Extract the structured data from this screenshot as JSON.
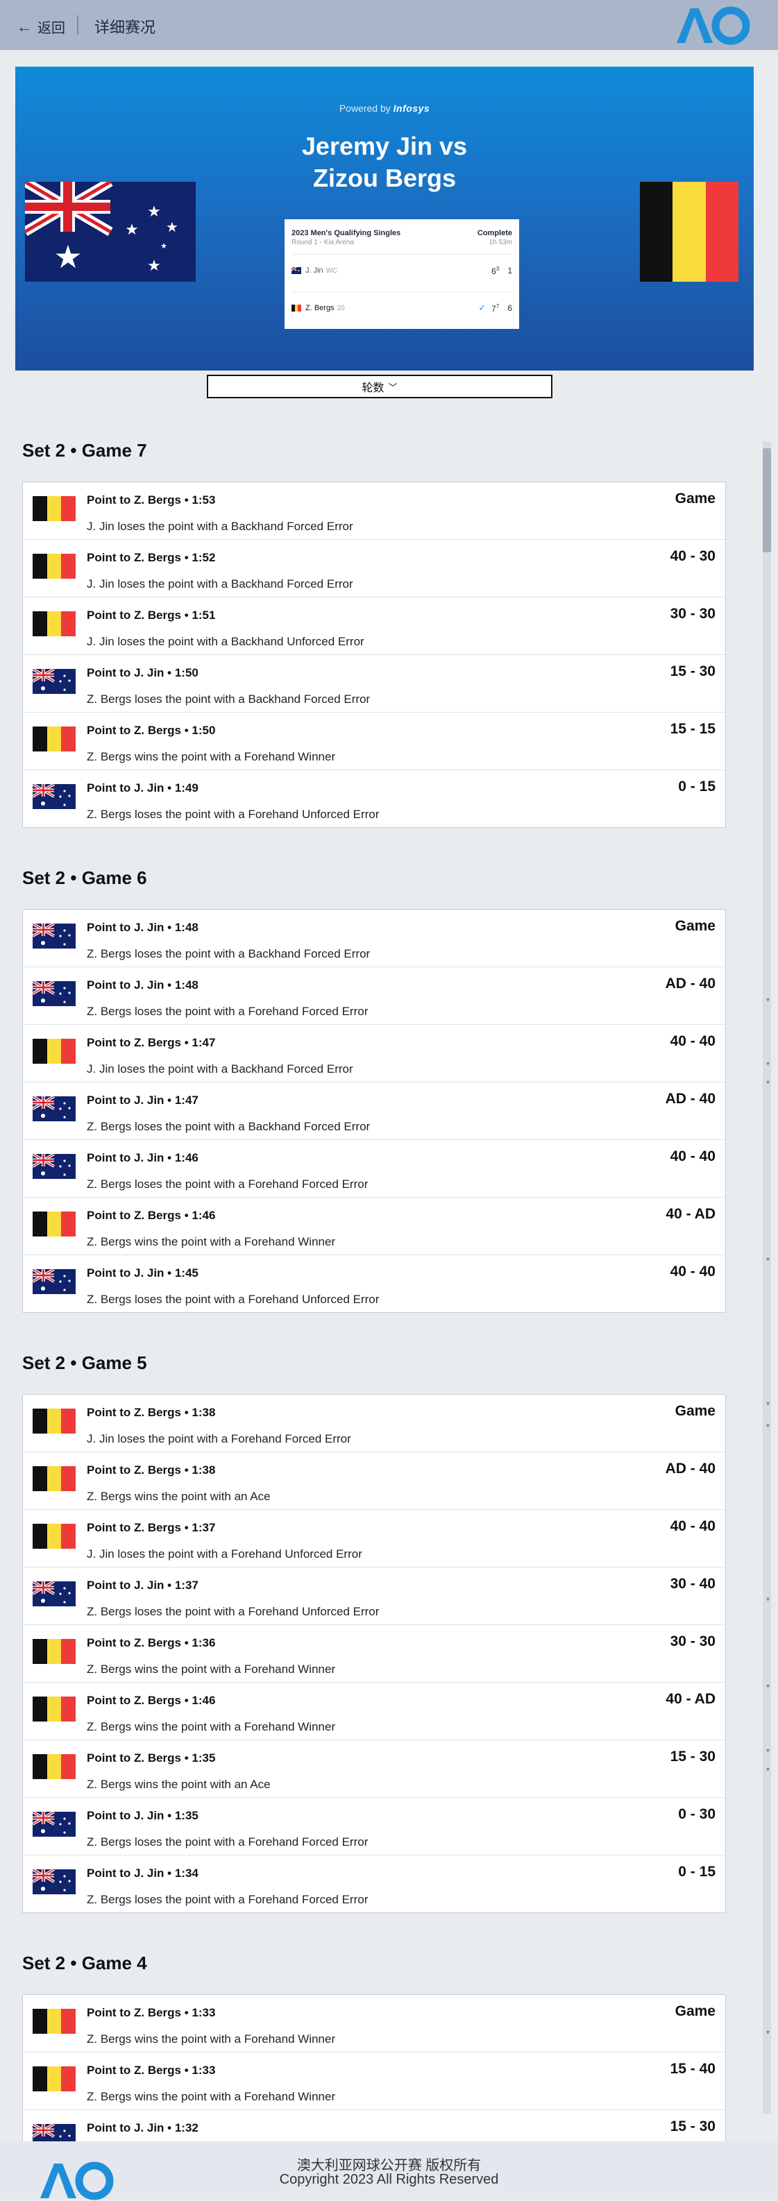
{
  "header": {
    "back_label": "返回",
    "title": "详细赛况"
  },
  "hero": {
    "powered_by": "Powered by",
    "powered_brand": "Infosys",
    "title_line1": "Jeremy Jin vs",
    "title_line2": "Zizou Bergs",
    "scorecard": {
      "event": "2023 Men's Qualifying Singles",
      "round": "Round 1 - Kia Arena",
      "status": "Complete",
      "duration": "1h 53m",
      "player1": {
        "name": "J. Jin",
        "seed": "WC",
        "set1": "6",
        "set1_tb": "3",
        "set2": "1"
      },
      "player2": {
        "name": "Z. Bergs",
        "seed": "20",
        "set1": "7",
        "set1_tb": "7",
        "set2": "6"
      }
    }
  },
  "rounds_select": {
    "label": "轮数"
  },
  "sets": [
    {
      "title": "Set 2 • Game 7",
      "points": [
        {
          "flag": "be",
          "title": "Point to Z. Bergs • 1:53",
          "desc": "J. Jin loses the point with a Backhand Forced Error",
          "score": "Game"
        },
        {
          "flag": "be",
          "title": "Point to Z. Bergs • 1:52",
          "desc": "J. Jin loses the point with a Backhand Forced Error",
          "score": "40 - 30"
        },
        {
          "flag": "be",
          "title": "Point to Z. Bergs • 1:51",
          "desc": "J. Jin loses the point with a Backhand Unforced Error",
          "score": "30 - 30"
        },
        {
          "flag": "au",
          "title": "Point to J. Jin • 1:50",
          "desc": "Z. Bergs loses the point with a Backhand Forced Error",
          "score": "15 - 30"
        },
        {
          "flag": "be",
          "title": "Point to Z. Bergs • 1:50",
          "desc": "Z. Bergs wins the point with a Forehand Winner",
          "score": "15 - 15"
        },
        {
          "flag": "au",
          "title": "Point to J. Jin • 1:49",
          "desc": "Z. Bergs loses the point with a Forehand Unforced Error",
          "score": "0 - 15"
        }
      ]
    },
    {
      "title": "Set 2 • Game 6",
      "points": [
        {
          "flag": "au",
          "title": "Point to J. Jin • 1:48",
          "desc": "Z. Bergs loses the point with a Backhand Forced Error",
          "score": "Game"
        },
        {
          "flag": "au",
          "title": "Point to J. Jin • 1:48",
          "desc": "Z. Bergs loses the point with a Forehand Forced Error",
          "score": "AD - 40"
        },
        {
          "flag": "be",
          "title": "Point to Z. Bergs • 1:47",
          "desc": "J. Jin loses the point with a Backhand Forced Error",
          "score": "40 - 40"
        },
        {
          "flag": "au",
          "title": "Point to J. Jin • 1:47",
          "desc": "Z. Bergs loses the point with a Backhand Forced Error",
          "score": "AD - 40"
        },
        {
          "flag": "au",
          "title": "Point to J. Jin • 1:46",
          "desc": "Z. Bergs loses the point with a Forehand Forced Error",
          "score": "40 - 40"
        },
        {
          "flag": "be",
          "title": "Point to Z. Bergs • 1:46",
          "desc": "Z. Bergs wins the point with a Forehand Winner",
          "score": "40 - AD"
        },
        {
          "flag": "au",
          "title": "Point to J. Jin • 1:45",
          "desc": "Z. Bergs loses the point with a Forehand Unforced Error",
          "score": "40 - 40"
        }
      ]
    },
    {
      "title": "Set 2 • Game 5",
      "points": [
        {
          "flag": "be",
          "title": "Point to Z. Bergs • 1:38",
          "desc": "J. Jin loses the point with a Forehand Forced Error",
          "score": "Game"
        },
        {
          "flag": "be",
          "title": "Point to Z. Bergs • 1:38",
          "desc": "Z. Bergs wins the point with an Ace",
          "score": "AD - 40"
        },
        {
          "flag": "be",
          "title": "Point to Z. Bergs • 1:37",
          "desc": "J. Jin loses the point with a Forehand Unforced Error",
          "score": "40 - 40"
        },
        {
          "flag": "au",
          "title": "Point to J. Jin • 1:37",
          "desc": "Z. Bergs loses the point with a Forehand Unforced Error",
          "score": "30 - 40"
        },
        {
          "flag": "be",
          "title": "Point to Z. Bergs • 1:36",
          "desc": "Z. Bergs wins the point with a Forehand Winner",
          "score": "30 - 30"
        },
        {
          "flag": "be",
          "title": "Point to Z. Bergs • 1:46",
          "desc": "Z. Bergs wins the point with a Forehand Winner",
          "score": "40 - AD"
        },
        {
          "flag": "be",
          "title": "Point to Z. Bergs • 1:35",
          "desc": "Z. Bergs wins the point with an Ace",
          "score": "15 - 30"
        },
        {
          "flag": "au",
          "title": "Point to J. Jin • 1:35",
          "desc": "Z. Bergs loses the point with a Forehand Forced Error",
          "score": "0 - 30"
        },
        {
          "flag": "au",
          "title": "Point to J. Jin • 1:34",
          "desc": "Z. Bergs loses the point with a Forehand Forced Error",
          "score": "0 - 15"
        }
      ]
    },
    {
      "title": "Set 2 • Game 4",
      "points": [
        {
          "flag": "be",
          "title": "Point to Z. Bergs • 1:33",
          "desc": "Z. Bergs wins the point with a Forehand Winner",
          "score": "Game"
        },
        {
          "flag": "be",
          "title": "Point to Z. Bergs • 1:33",
          "desc": "Z. Bergs wins the point with a Forehand Winner",
          "score": "15 - 40"
        },
        {
          "flag": "au",
          "title": "Point to J. Jin • 1:32",
          "desc": "",
          "score": "15 - 30"
        }
      ]
    }
  ],
  "footer": {
    "line1": "澳大利亚网球公开赛 版权所有",
    "line2": "Copyright 2023 All Rights Reserved"
  },
  "colors": {
    "topbar": "#a9b6c9",
    "hero_top": "#0f8bd8",
    "hero_bottom": "#1d4e9e",
    "logo_blue": "#1e8fd8",
    "be_black": "#111111",
    "be_yellow": "#fadc3c",
    "be_red": "#ee3a3a",
    "au_blue": "#10236b"
  }
}
